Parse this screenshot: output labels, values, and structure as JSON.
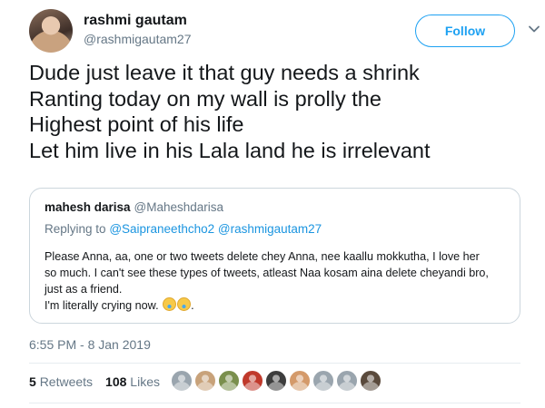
{
  "author": {
    "display_name": "rashmi gautam",
    "handle": "@rashmigautam27"
  },
  "follow_button": {
    "label": "Follow"
  },
  "tweet": {
    "lines": [
      "Dude just leave it that guy needs a shrink",
      "Ranting today on my wall is prolly the",
      "Highest point of his life",
      "Let him live in his Lala land he is irrelevant"
    ]
  },
  "quoted_tweet": {
    "display_name": "mahesh darisa",
    "handle": "@Maheshdarisa",
    "replying_prefix": "Replying to",
    "replying_to": [
      "@Saipraneethcho2",
      "@rashmigautam27"
    ],
    "lines": [
      "Please Anna, aa, one or two tweets delete chey Anna, nee kaallu mokkutha, I love her",
      "so much. I can't see these types of tweets, atleast Naa kosam aina delete cheyandi bro,",
      "just as a friend.",
      "I'm literally crying now."
    ],
    "emoji": [
      "loudly-crying-face-emoji",
      "loudly-crying-face-emoji"
    ],
    "trailing": "."
  },
  "timestamp": "6:55 PM - 8 Jan 2019",
  "stats": {
    "retweets_count": "5",
    "retweets_label": "Retweets",
    "likes_count": "108",
    "likes_label": "Likes"
  },
  "likers": [
    {
      "name": "default-avatar",
      "color": "#9aa5ae"
    },
    {
      "name": "user-avatar",
      "color": "#c8a27a"
    },
    {
      "name": "user-avatar",
      "color": "#7a8f4d"
    },
    {
      "name": "user-avatar",
      "color": "#c0392b"
    },
    {
      "name": "user-avatar",
      "color": "#3d3d3d"
    },
    {
      "name": "user-avatar",
      "color": "#d49a6a"
    },
    {
      "name": "default-avatar",
      "color": "#9aa5ae"
    },
    {
      "name": "default-avatar",
      "color": "#9aa5ae"
    },
    {
      "name": "user-avatar",
      "color": "#5a4a3c"
    }
  ],
  "colors": {
    "accent": "#1da1f2",
    "secondary_text": "#657786",
    "primary_text": "#14171a",
    "border": "#ccd6dd"
  }
}
